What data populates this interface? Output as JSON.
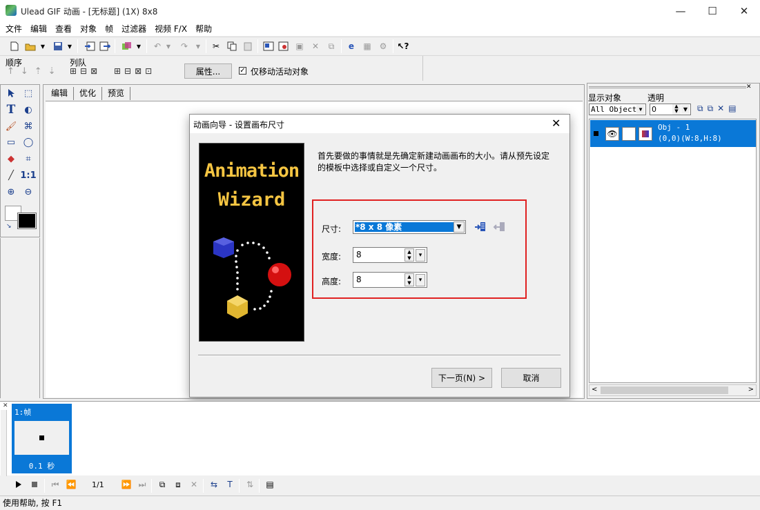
{
  "window": {
    "title": "Ulead GIF 动画 - [无标题] (1X) 8x8",
    "min": "—",
    "max": "☐",
    "close": "✕"
  },
  "menu": [
    "文件",
    "编辑",
    "查看",
    "对象",
    "帧",
    "过滤器",
    "视频 F/X",
    "帮助"
  ],
  "toolbar2": {
    "order_label": "顺序",
    "queue_label": "列队",
    "properties_button": "属性...",
    "move_active_checkbox": "仅移动活动对象",
    "move_active_checked": true
  },
  "tabs": [
    "编辑",
    "优化",
    "预览"
  ],
  "right_panel": {
    "display_label": "显示对象",
    "transparency_label": "透明",
    "display_select": "All Object:",
    "transparency_value": "0",
    "object": {
      "name": "Obj - 1",
      "info": "(0,0)(W:8,H:8)"
    }
  },
  "dialog": {
    "title": "动画向导 - 设置画布尺寸",
    "description": "首先要做的事情就是先确定新建动画画布的大小。请从预先设定的模板中选择或自定义一个尺寸。",
    "wizard_text": [
      "Animation",
      "Wizard"
    ],
    "size_label": "尺寸:",
    "size_value": "*8 x 8 像素",
    "width_label": "宽度:",
    "width_value": "8",
    "height_label": "高度:",
    "height_value": "8",
    "next_button": "下一页(N) >",
    "cancel_button": "取消"
  },
  "frame": {
    "label": "1:帧",
    "delay": "0.1 秒"
  },
  "playback": {
    "counter": "1/1"
  },
  "status": "使用帮助, 按 F1",
  "colors": {
    "selection": "#0a78d7",
    "highlight_border": "#e02020"
  }
}
